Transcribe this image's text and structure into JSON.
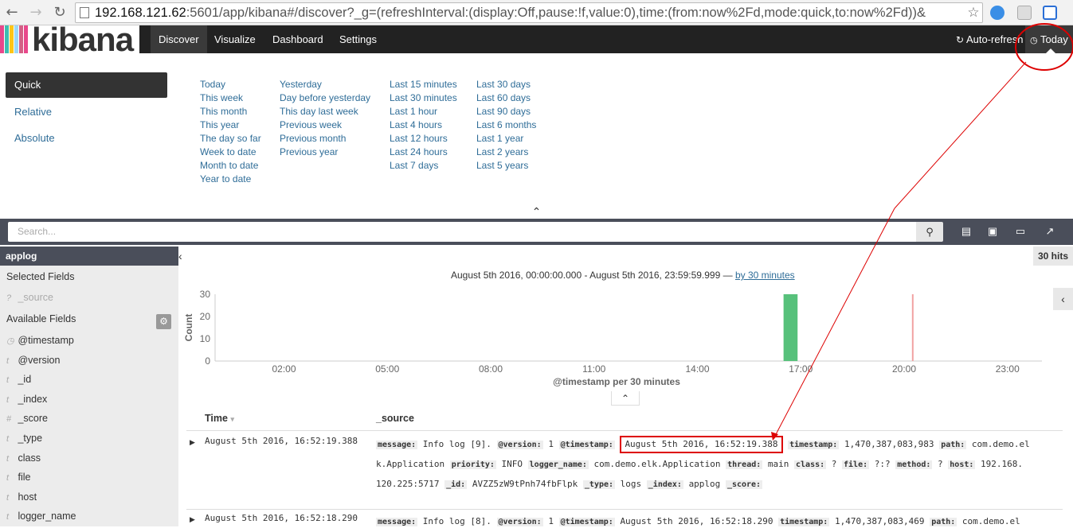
{
  "browser": {
    "url_host": "192.168.121.62",
    "url_rest": ":5601/app/kibana#/discover?_g=(refreshInterval:(display:Off,pause:!f,value:0),time:(from:now%2Fd,mode:quick,to:now%2Fd))&",
    "back_icon": "arrow-left-icon",
    "forward_icon": "arrow-right-icon",
    "reload_icon": "reload-icon"
  },
  "nav": {
    "logo_text": "kibana",
    "tabs": [
      "Discover",
      "Visualize",
      "Dashboard",
      "Settings"
    ],
    "auto_refresh": "Auto-refresh",
    "today": "Today"
  },
  "picker": {
    "modes": [
      "Quick",
      "Relative",
      "Absolute"
    ],
    "col1": [
      "Today",
      "This week",
      "This month",
      "This year",
      "The day so far",
      "Week to date",
      "Month to date",
      "Year to date"
    ],
    "col2": [
      "Yesterday",
      "Day before yesterday",
      "This day last week",
      "Previous week",
      "Previous month",
      "Previous year"
    ],
    "col3": [
      "Last 15 minutes",
      "Last 30 minutes",
      "Last 1 hour",
      "Last 4 hours",
      "Last 12 hours",
      "Last 24 hours",
      "Last 7 days"
    ],
    "col4": [
      "Last 30 days",
      "Last 60 days",
      "Last 90 days",
      "Last 6 months",
      "Last 1 year",
      "Last 2 years",
      "Last 5 years"
    ]
  },
  "search": {
    "placeholder": "Search..."
  },
  "sidebar": {
    "index": "applog",
    "selected_header": "Selected Fields",
    "selected": [
      {
        "type": "?",
        "name": "_source"
      }
    ],
    "available_header": "Available Fields",
    "fields": [
      {
        "type": "◷",
        "name": "@timestamp"
      },
      {
        "type": "t",
        "name": "@version"
      },
      {
        "type": "t",
        "name": "_id"
      },
      {
        "type": "t",
        "name": "_index"
      },
      {
        "type": "#",
        "name": "_score"
      },
      {
        "type": "t",
        "name": "_type"
      },
      {
        "type": "t",
        "name": "class"
      },
      {
        "type": "t",
        "name": "file"
      },
      {
        "type": "t",
        "name": "host"
      },
      {
        "type": "t",
        "name": "logger_name"
      }
    ]
  },
  "main": {
    "hits": "30 hits",
    "range_text": "August 5th 2016, 00:00:00.000 - August 5th 2016, 23:59:59.999 — ",
    "interval_link": "by 30 minutes",
    "col_time": "Time",
    "col_source": "_source"
  },
  "chart_data": {
    "type": "bar",
    "xlabel": "@timestamp per 30 minutes",
    "ylabel": "Count",
    "ylim": [
      0,
      30
    ],
    "yticks": [
      0,
      10,
      20,
      30
    ],
    "xticks": [
      "02:00",
      "05:00",
      "08:00",
      "11:00",
      "14:00",
      "17:00",
      "20:00",
      "23:00"
    ],
    "x_start_hour": 0,
    "x_end_hour": 24,
    "bars": [
      {
        "start_hour": 16.5,
        "end_hour": 17.0,
        "value": 30
      }
    ],
    "now_marker_hour": 20.25,
    "bar_color": "#57c17b",
    "marker_color": "#f1a2a2"
  },
  "rows": [
    {
      "time": "August 5th 2016, 16:52:19.388",
      "lines": [
        [
          [
            "message:",
            "Info log [9]."
          ],
          [
            "@version:",
            "1"
          ],
          [
            "@timestamp:",
            "August 5th 2016, 16:52:19.388",
            true
          ],
          [
            "timestamp:",
            "1,470,387,083,983"
          ],
          [
            "path:",
            "com.demo.el"
          ]
        ],
        [
          [
            "",
            "k.Application"
          ],
          [
            "priority:",
            "INFO"
          ],
          [
            "logger_name:",
            "com.demo.elk.Application"
          ],
          [
            "thread:",
            "main"
          ],
          [
            "class:",
            "?"
          ],
          [
            "file:",
            "?:?"
          ],
          [
            "method:",
            "?"
          ],
          [
            "host:",
            "192.168."
          ]
        ],
        [
          [
            "",
            "120.225:5717"
          ],
          [
            "_id:",
            "AVZZ5zW9tPnh74fbFlpk"
          ],
          [
            "_type:",
            "logs"
          ],
          [
            "_index:",
            "applog"
          ],
          [
            "_score:",
            ""
          ]
        ]
      ]
    },
    {
      "time": "August 5th 2016, 16:52:18.290",
      "lines": [
        [
          [
            "message:",
            "Info log [8]."
          ],
          [
            "@version:",
            "1"
          ],
          [
            "@timestamp:",
            "August 5th 2016, 16:52:18.290"
          ],
          [
            "timestamp:",
            "1,470,387,083,469"
          ],
          [
            "path:",
            "com.demo.el"
          ]
        ]
      ]
    }
  ]
}
